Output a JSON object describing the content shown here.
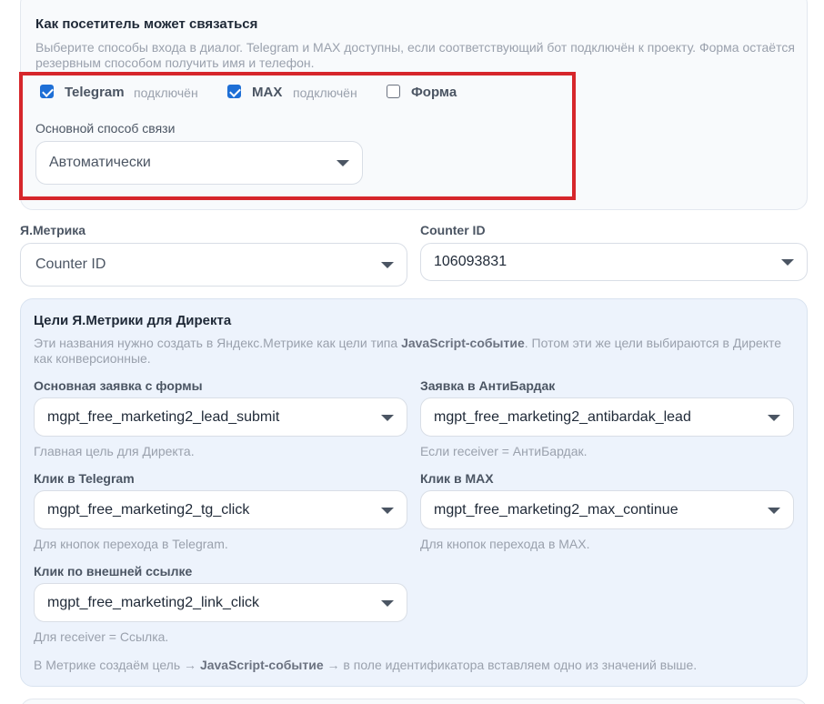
{
  "contact": {
    "title": "Как посетитель может связаться",
    "description": "Выберите способы входа в диалог. Telegram и MAX доступны, если соответствующий бот подключён к проекту. Форма остаётся резервным способом получить имя и телефон.",
    "options": [
      {
        "name": "Telegram",
        "state": "подключён",
        "checked": true
      },
      {
        "name": "MAX",
        "state": "подключён",
        "checked": true
      },
      {
        "name": "Форма",
        "state": "",
        "checked": false
      }
    ],
    "primary_label": "Основной способ связи",
    "primary_value": "Автоматически"
  },
  "metrika": {
    "label": "Я.Метрика",
    "select_value": "Counter ID",
    "counter_label": "Counter ID",
    "counter_value": "106093831"
  },
  "goals": {
    "title": "Цели Я.Метрики для Директа",
    "desc_part1": "Эти названия нужно создать в Яндекс.Метрике как цели типа ",
    "desc_bold": "JavaScript-событие",
    "desc_part2": ". Потом эти же цели выбираются в Директе как конверсионные.",
    "fields": [
      {
        "label": "Основная заявка с формы",
        "value": "mgpt_free_marketing2_lead_submit",
        "hint": "Главная цель для Директа."
      },
      {
        "label": "Заявка в АнтиБардак",
        "value": "mgpt_free_marketing2_antibardak_lead",
        "hint": "Если receiver = АнтиБардак."
      },
      {
        "label": "Клик в Telegram",
        "value": "mgpt_free_marketing2_tg_click",
        "hint": "Для кнопок перехода в Telegram."
      },
      {
        "label": "Клик в MAX",
        "value": "mgpt_free_marketing2_max_continue",
        "hint": "Для кнопок перехода в MAX."
      },
      {
        "label": "Клик по внешней ссылке",
        "value": "mgpt_free_marketing2_link_click",
        "hint": "Для receiver = Ссылка."
      }
    ],
    "footer_part1": "В Метрике создаём цель → ",
    "footer_bold": "JavaScript-событие",
    "footer_part2": " → в поле идентификатора вставляем одно из значений выше."
  }
}
